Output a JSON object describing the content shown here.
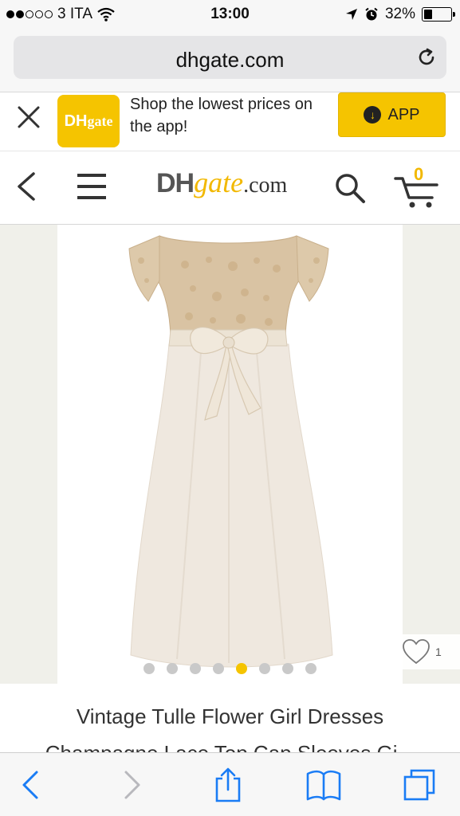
{
  "status_bar": {
    "carrier": "3 ITA",
    "time": "13:00",
    "battery": "32%",
    "battery_level": 0.32,
    "signal_bars_on": 2,
    "signal_bars_total": 5
  },
  "address_bar": {
    "url": "dhgate.com"
  },
  "app_banner": {
    "logo_text_dh": "DH",
    "logo_text_gate": "gate",
    "message": "Shop the lowest prices on the app!",
    "app_button_label": "APP"
  },
  "site_header": {
    "brand_dh": "DH",
    "brand_gate": "gate",
    "brand_com": ".com",
    "cart_count": "0"
  },
  "gallery": {
    "favorite_count": "1",
    "dots_total": 8,
    "active_dot_index": 4
  },
  "product": {
    "title_line1": "Vintage Tulle Flower Girl Dresses",
    "title_line2": "Champagne Lace Top Cap Sleeves Gi..."
  },
  "colors": {
    "brand_yellow": "#f5c400",
    "ios_blue": "#1a7cf5"
  }
}
